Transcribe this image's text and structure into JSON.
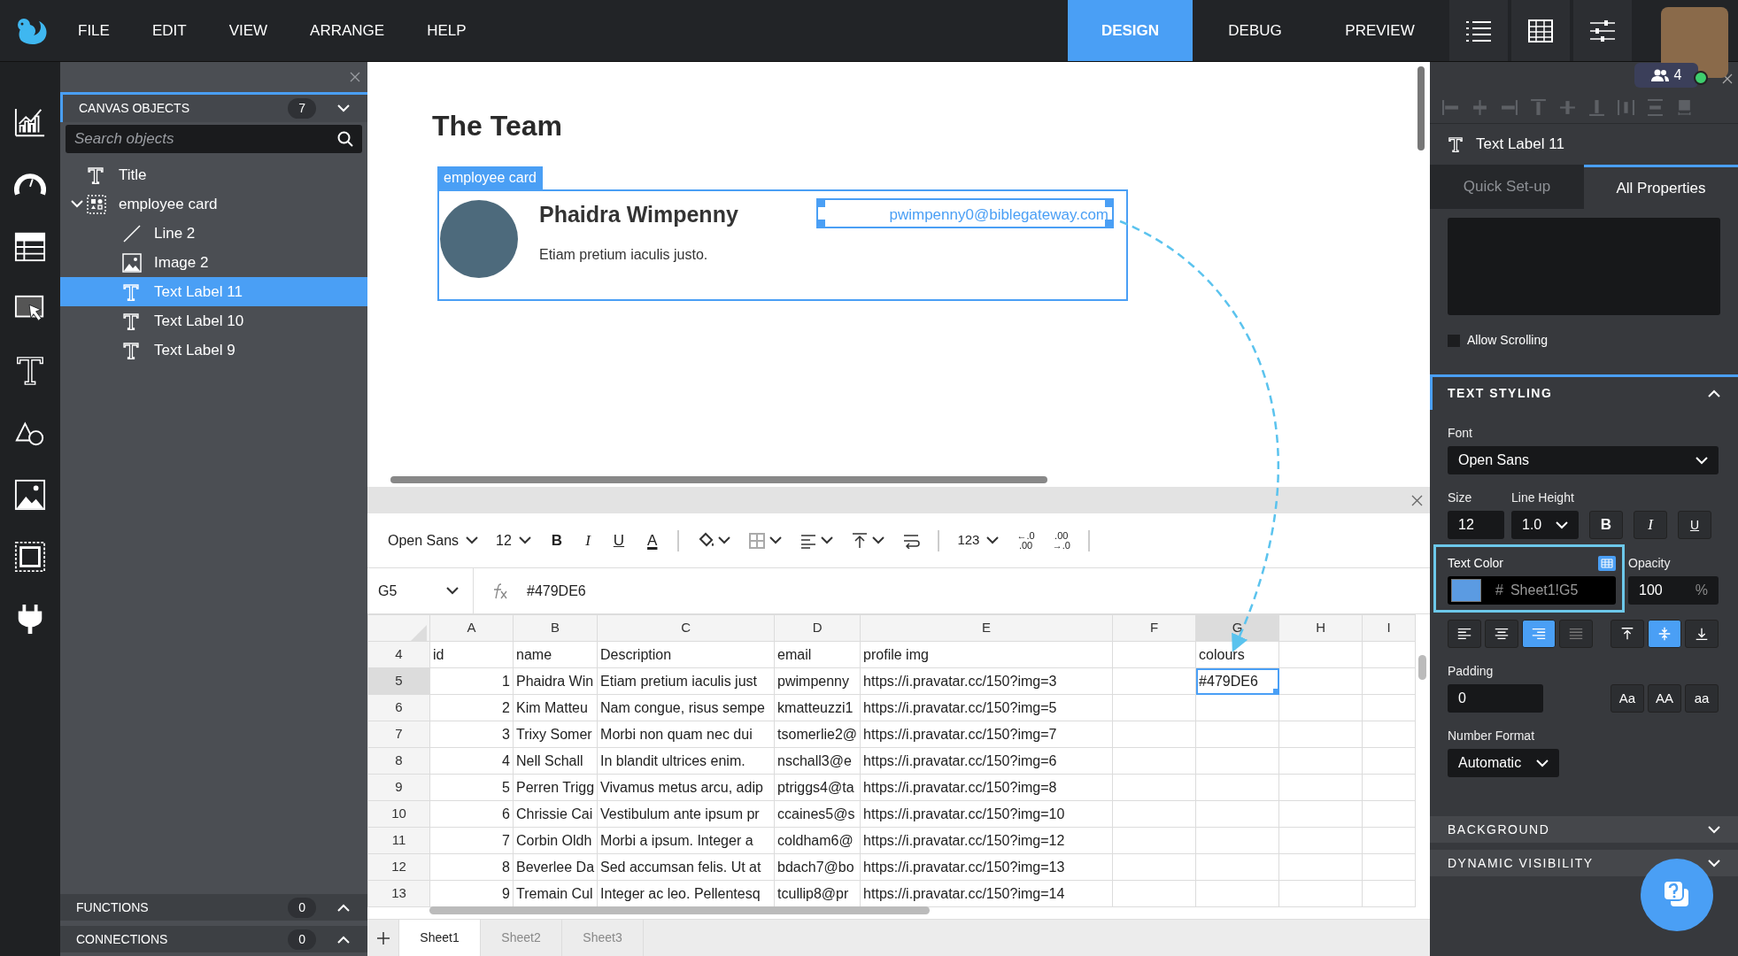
{
  "menu": [
    "FILE",
    "EDIT",
    "VIEW",
    "ARRANGE",
    "HELP"
  ],
  "mode_tabs": [
    {
      "label": "DESIGN",
      "selected": true
    },
    {
      "label": "DEBUG",
      "selected": false
    },
    {
      "label": "PREVIEW",
      "selected": false
    }
  ],
  "collaborators": {
    "count": "4",
    "online": true
  },
  "objects_panel": {
    "title": "CANVAS OBJECTS",
    "count": "7",
    "expanded": true,
    "search": {
      "placeholder": "Search objects"
    },
    "items": [
      {
        "label": "Title",
        "kind": "text",
        "selected": false
      },
      {
        "label": "employee card",
        "kind": "group",
        "selected": false,
        "expanded": true,
        "children": [
          {
            "label": "Line 2",
            "kind": "line",
            "selected": false
          },
          {
            "label": "Image 2",
            "kind": "image",
            "selected": false
          },
          {
            "label": "Text Label 11",
            "kind": "text",
            "selected": true
          },
          {
            "label": "Text Label 10",
            "kind": "text",
            "selected": false
          },
          {
            "label": "Text Label 9",
            "kind": "text",
            "selected": false
          }
        ]
      }
    ]
  },
  "footer_sections": [
    {
      "title": "FUNCTIONS",
      "count": "0",
      "expanded": false
    },
    {
      "title": "CONNECTIONS",
      "count": "0",
      "expanded": false
    }
  ],
  "canvas": {
    "title": "The Team",
    "card": {
      "tag": "employee card",
      "name": "Phaidra Wimpenny",
      "description": "Etiam pretium iaculis justo.",
      "email": "pwimpenny0@biblegateway.com",
      "email_selected": true
    }
  },
  "sheet": {
    "toolbar": {
      "font": "Open Sans",
      "size": "12",
      "format_buttons": [
        "B",
        "I",
        "U",
        "A"
      ],
      "number_format": "123",
      "decimal_buttons": [
        {
          "top": "←.0",
          "bottom": ".00"
        },
        {
          "top": ".00",
          "bottom": "→.0"
        }
      ]
    },
    "cell_ref": "G5",
    "formula": "#479DE6",
    "columns": [
      {
        "label": "A",
        "selected": false
      },
      {
        "label": "B",
        "selected": false
      },
      {
        "label": "C",
        "selected": false
      },
      {
        "label": "D",
        "selected": false
      },
      {
        "label": "E",
        "selected": false
      },
      {
        "label": "F",
        "selected": false
      },
      {
        "label": "G",
        "selected": true
      },
      {
        "label": "H",
        "selected": false
      },
      {
        "label": "I",
        "selected": false
      }
    ],
    "rows": [
      {
        "number": "4",
        "selected": false,
        "cells": {
          "A": "id",
          "B": "name",
          "C": "Description",
          "D": "email",
          "E": "profile img",
          "G": "colours"
        }
      },
      {
        "number": "5",
        "selected": true,
        "cells": {
          "A": "1",
          "B": "Phaidra Win",
          "C": "Etiam pretium iaculis just",
          "D": "pwimpenny",
          "E": "https://i.pravatar.cc/150?img=3",
          "G": "#479DE6"
        }
      },
      {
        "number": "6",
        "selected": false,
        "cells": {
          "A": "2",
          "B": "Kim Matteu",
          "C": "Nam congue, risus sempe",
          "D": "kmatteuzzi1",
          "E": "https://i.pravatar.cc/150?img=5"
        }
      },
      {
        "number": "7",
        "selected": false,
        "cells": {
          "A": "3",
          "B": "Trixy Somer",
          "C": "Morbi non quam nec dui",
          "D": "tsomerlie2@",
          "E": "https://i.pravatar.cc/150?img=7"
        }
      },
      {
        "number": "8",
        "selected": false,
        "cells": {
          "A": "4",
          "B": "Nell Schall",
          "C": "In blandit ultrices enim.",
          "D": "nschall3@e",
          "E": "https://i.pravatar.cc/150?img=6"
        }
      },
      {
        "number": "9",
        "selected": false,
        "cells": {
          "A": "5",
          "B": "Perren Trigg",
          "C": "Vivamus metus arcu, adip",
          "D": "ptriggs4@ta",
          "E": "https://i.pravatar.cc/150?img=8"
        }
      },
      {
        "number": "10",
        "selected": false,
        "cells": {
          "A": "6",
          "B": "Chrissie Cai",
          "C": "Vestibulum ante ipsum pr",
          "D": "ccaines5@s",
          "E": "https://i.pravatar.cc/150?img=10"
        }
      },
      {
        "number": "11",
        "selected": false,
        "cells": {
          "A": "7",
          "B": "Corbin Oldh",
          "C": "Morbi a ipsum. Integer a",
          "D": "coldham6@",
          "E": "https://i.pravatar.cc/150?img=12"
        }
      },
      {
        "number": "12",
        "selected": false,
        "cells": {
          "A": "8",
          "B": "Beverlee Da",
          "C": "Sed accumsan felis. Ut at",
          "D": "bdach7@bo",
          "E": "https://i.pravatar.cc/150?img=13"
        }
      },
      {
        "number": "13",
        "selected": false,
        "cells": {
          "A": "9",
          "B": "Tremain Cul",
          "C": "Integer ac leo. Pellentesq",
          "D": "tcullip8@pr",
          "E": "https://i.pravatar.cc/150?img=14"
        }
      }
    ],
    "tabs": [
      {
        "label": "Sheet1",
        "selected": true
      },
      {
        "label": "Sheet2",
        "selected": false
      },
      {
        "label": "Sheet3",
        "selected": false
      }
    ]
  },
  "properties": {
    "object": {
      "kind": "text",
      "name": "Text Label 11"
    },
    "tabs": [
      {
        "label": "Quick Set-up",
        "selected": false
      },
      {
        "label": "All Properties",
        "selected": true
      }
    ],
    "allow_scrolling": {
      "label": "Allow Scrolling",
      "checked": false
    },
    "text_styling": {
      "title": "TEXT STYLING",
      "expanded": true,
      "font": {
        "label": "Font",
        "value": "Open Sans"
      },
      "size": {
        "label": "Size",
        "value": "12"
      },
      "line_height": {
        "label": "Line Height",
        "value": "1.0"
      },
      "style_buttons": [
        "B",
        "I",
        "U"
      ],
      "text_color": {
        "label": "Text Color",
        "color": "#5b9be2",
        "prefix": "#",
        "value": "Sheet1!G5",
        "linked": true
      },
      "opacity": {
        "label": "Opacity",
        "value": "100",
        "unit": "%"
      },
      "h_align": [
        {
          "kind": "left",
          "selected": false,
          "disabled": false
        },
        {
          "kind": "center",
          "selected": false,
          "disabled": false
        },
        {
          "kind": "right",
          "selected": true,
          "disabled": false
        },
        {
          "kind": "justify",
          "selected": false,
          "disabled": true
        }
      ],
      "v_align": [
        {
          "kind": "top",
          "selected": false
        },
        {
          "kind": "middle",
          "selected": true
        },
        {
          "kind": "bottom",
          "selected": false
        }
      ],
      "padding": {
        "label": "Padding",
        "value": "0"
      },
      "case_buttons": [
        "Aa",
        "AA",
        "aa"
      ],
      "number_format": {
        "label": "Number Format",
        "value": "Automatic"
      }
    },
    "sections": [
      {
        "title": "BACKGROUND",
        "expanded": false
      },
      {
        "title": "DYNAMIC VISIBILITY",
        "expanded": false
      }
    ]
  }
}
